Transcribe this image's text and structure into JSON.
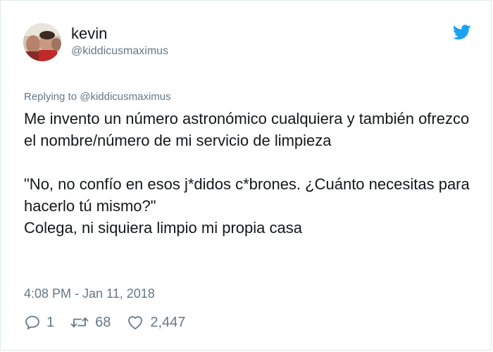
{
  "tweet": {
    "author_name": "kevin",
    "author_handle": "@kiddicusmaximus",
    "replying_to": "Replying to @kiddicusmaximus",
    "lines": [
      "Me invento un número astronómico cualquiera y también ofrezco el nombre/número de mi servicio de limpieza",
      "",
      "\"No, no confío en esos j*didos c*brones. ¿Cuánto necesitas para hacerlo tú mismo?\"",
      "Colega, ni siquiera limpio mi propia casa"
    ],
    "timestamp": "4:08 PM - Jan 11, 2018",
    "counts": {
      "replies": "1",
      "retweets": "68",
      "likes": "2,447"
    }
  },
  "icons": {
    "brand": "twitter-bird-icon",
    "reply": "reply-bubble-icon",
    "retweet": "retweet-icon",
    "like": "heart-icon"
  },
  "colors": {
    "twitter_blue": "#1da1f2",
    "secondary_text": "#657786",
    "primary_text": "#14171a",
    "border": "#e1e8ed"
  }
}
